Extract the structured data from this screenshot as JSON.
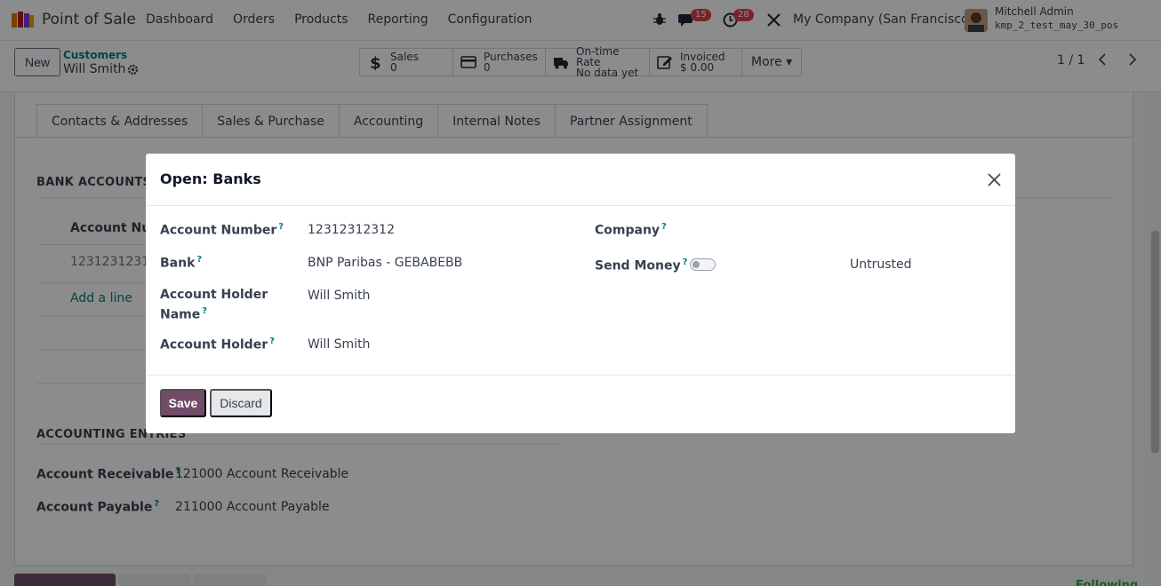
{
  "navbar": {
    "app_name": "Point of Sale",
    "menu": [
      "Dashboard",
      "Orders",
      "Products",
      "Reporting",
      "Configuration"
    ],
    "chat_count": "15",
    "activity_count": "28",
    "company": "My Company (San Francisco)",
    "user_name": "Mitchell Admin",
    "db_name": "kmp_2_test_may_30_pos"
  },
  "control": {
    "new_label": "New",
    "breadcrumb": "Customers",
    "record_name": "Will Smith",
    "smart_buttons": [
      {
        "label": "Sales",
        "value": "0"
      },
      {
        "label": "Purchases",
        "value": "0"
      },
      {
        "label": "On-time Rate",
        "value": "No data yet"
      },
      {
        "label": "Invoiced",
        "value": "$ 0.00"
      }
    ],
    "more_label": "More ▾",
    "pager": "1 / 1"
  },
  "form": {
    "tabs": [
      "Contacts & Addresses",
      "Sales & Purchase",
      "Accounting",
      "Internal Notes",
      "Partner Assignment"
    ],
    "bank_accounts_title": "BANK ACCOUNTS",
    "account_num_col": "Account Num",
    "account_row_value": "12312312312",
    "add_line": "Add a line",
    "accounting_entries_title": "ACCOUNTING ENTRIES",
    "receivable_label": "Account Receivable",
    "receivable_value": "121000 Account Receivable",
    "payable_label": "Account Payable",
    "payable_value": "211000 Account Payable",
    "following": "Following"
  },
  "dialog": {
    "title": "Open: Banks",
    "account_number_label": "Account Number",
    "account_number_value": "12312312312",
    "bank_label": "Bank",
    "bank_value": "BNP Paribas - GEBABEBB",
    "holder_name_label_1": "Account Holder",
    "holder_name_label_2": "Name",
    "holder_name_value": "Will Smith",
    "holder_label": "Account Holder",
    "holder_value": "Will Smith",
    "company_label": "Company",
    "company_value": "",
    "send_money_label": "Send Money",
    "send_money_status": "Untrusted",
    "save_label": "Save",
    "discard_label": "Discard"
  },
  "colors": {
    "primary": "#714b67",
    "link": "#017e84",
    "badge": "#e0404e"
  }
}
